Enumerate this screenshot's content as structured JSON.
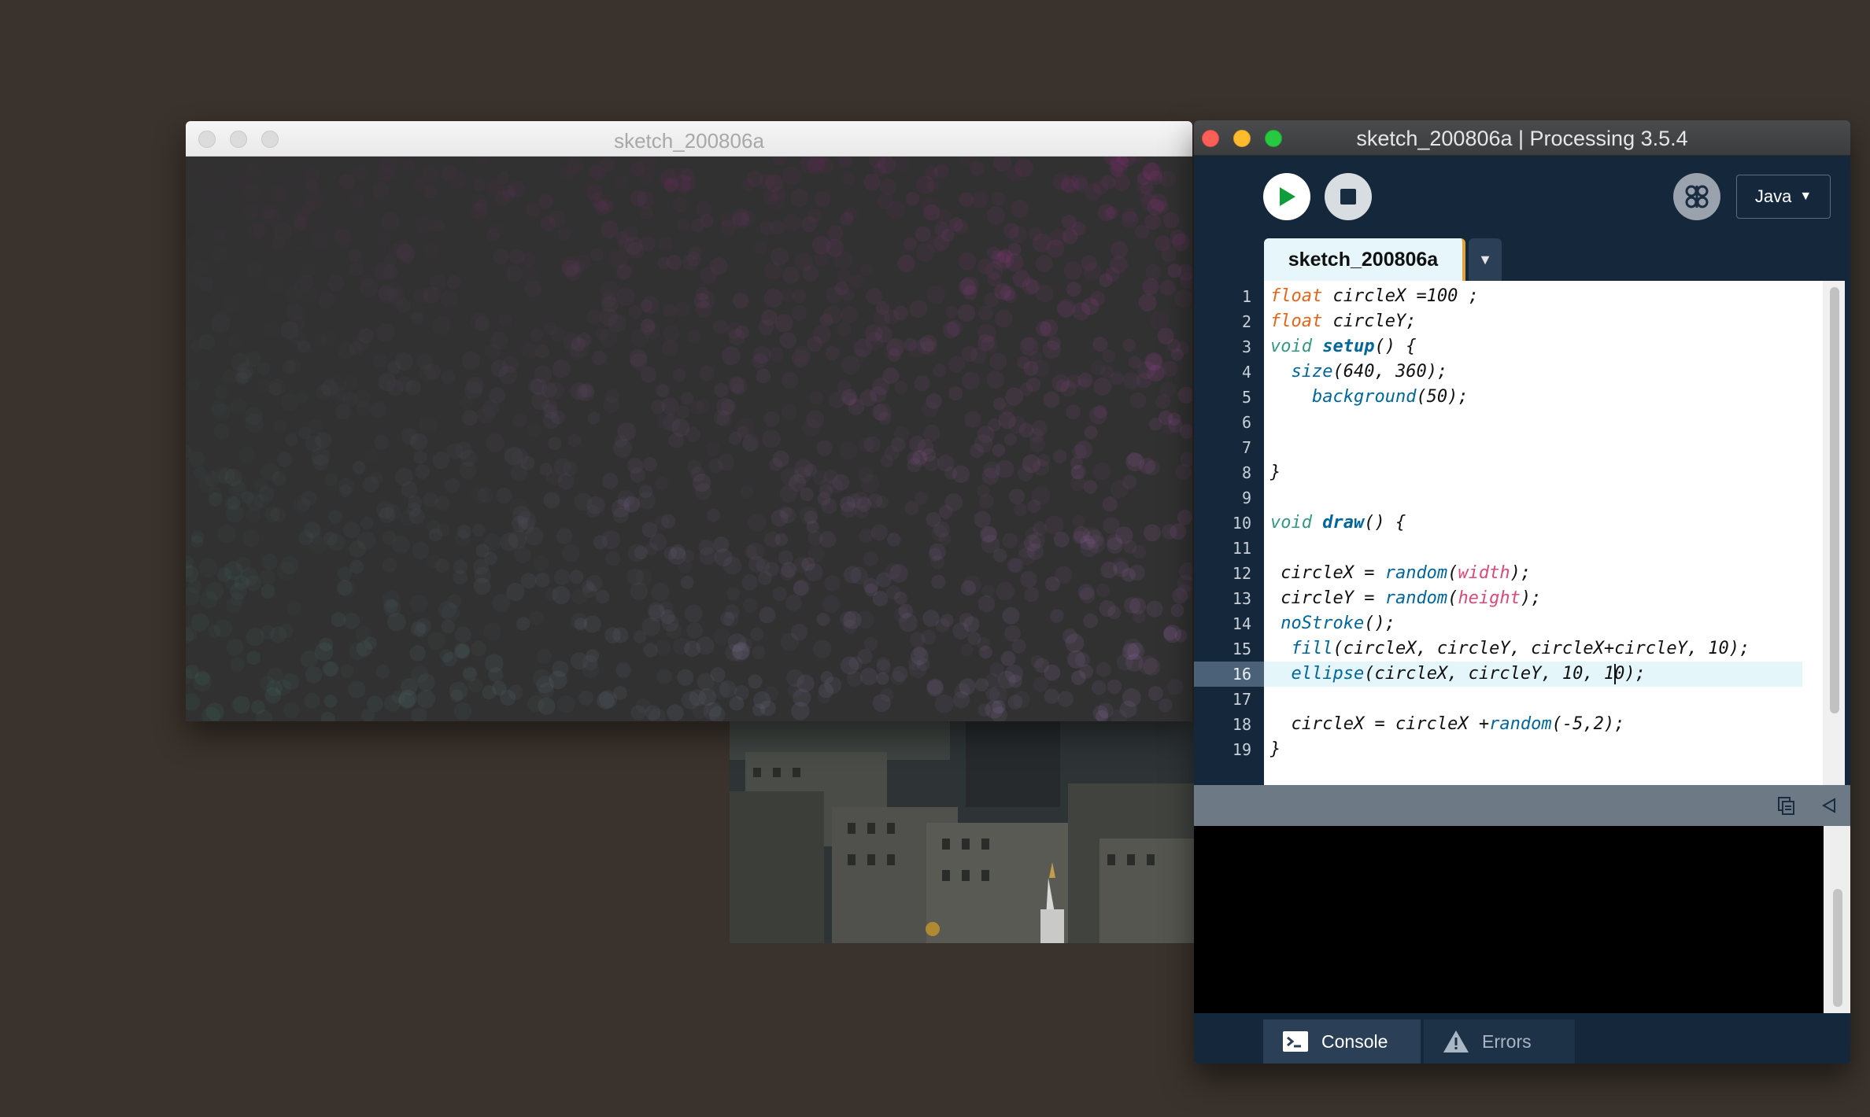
{
  "sketch_window": {
    "title": "sketch_200806a"
  },
  "ide_window": {
    "title": "sketch_200806a | Processing 3.5.4",
    "toolbar": {
      "run_icon": "play-icon",
      "stop_icon": "stop-icon",
      "debug_icon": "butterfly-icon",
      "mode_label": "Java",
      "mode_arrow": "▼"
    },
    "tab": {
      "name": "sketch_200806a",
      "menu_arrow": "▼"
    },
    "editor": {
      "current_line": 16,
      "lines": [
        "float circleX =100 ;",
        "float circleY;",
        "void setup() {",
        "  size(640, 360);",
        "    background(50);",
        "",
        "",
        "}",
        "",
        "void draw() {",
        "",
        " circleX = random(width);",
        " circleY = random(height);",
        " noStroke();",
        "  fill(circleX, circleY, circleX+circleY, 10);",
        "  ellipse(circleX, circleY, 10, 10);",
        "",
        "  circleX = circleX +random(-5,2);",
        "}"
      ]
    },
    "console_tools": {
      "copy_icon": "copy-icon",
      "collapse_icon": "collapse-icon"
    },
    "footer": {
      "console_label": "Console",
      "errors_label": "Errors"
    }
  },
  "colors": {
    "ide_background": "#14273b",
    "editor_background": "#ffffff",
    "current_line_highlight": "#e5f6fb",
    "tab_accent": "#e2a23a",
    "keyword_type": "#e2661a",
    "keyword_function": "#006699",
    "keyword_constant": "#d94a7a",
    "close_button": "#fc5f57",
    "minimize_button": "#fdbc2e",
    "zoom_button": "#28c840"
  }
}
